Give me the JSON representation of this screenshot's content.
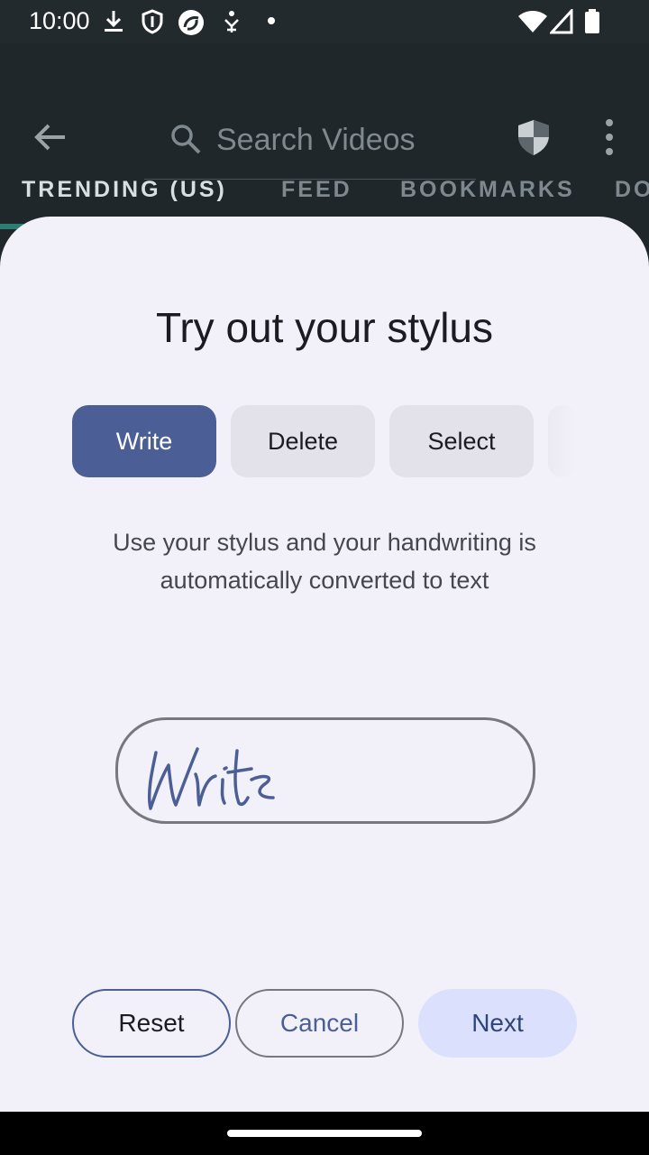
{
  "status_bar": {
    "time": "10:00",
    "icons": [
      "download-icon",
      "shield-outline-icon",
      "app-logo-icon",
      "accessibility-icon",
      "dot-icon",
      "wifi-icon",
      "cell-signal-icon",
      "battery-icon"
    ]
  },
  "app_bar": {
    "search_placeholder": "Search Videos",
    "tabs": [
      {
        "label": "TRENDING (US)",
        "active": true
      },
      {
        "label": "FEED",
        "active": false
      },
      {
        "label": "BOOKMARKS",
        "active": false
      },
      {
        "label": "DO",
        "active": false
      }
    ],
    "indicator_color": "#2c7d74"
  },
  "sheet": {
    "title": "Try out your stylus",
    "modes": [
      {
        "label": "Write",
        "selected": true
      },
      {
        "label": "Delete",
        "selected": false
      },
      {
        "label": "Select",
        "selected": false
      }
    ],
    "description": "Use your stylus and your handwriting is automatically converted to text",
    "handwriting_sample": "Write",
    "buttons": {
      "reset": "Reset",
      "cancel": "Cancel",
      "next": "Next"
    }
  },
  "colors": {
    "accent": "#4b5e95",
    "sheet_background": "#f2f1f9",
    "app_background": "#20272b"
  }
}
